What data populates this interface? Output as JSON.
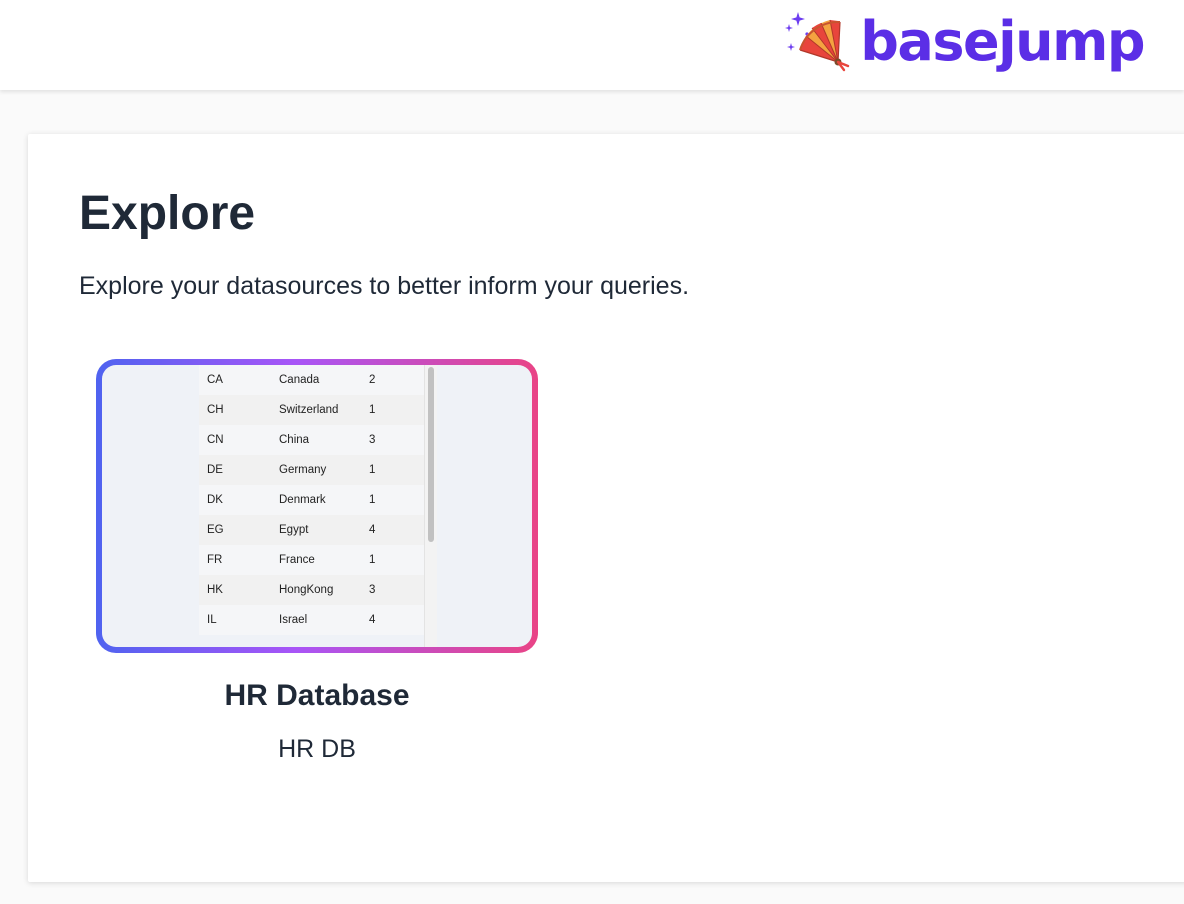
{
  "header": {
    "logo_text": "basejump",
    "logo_icon": "fan-sparkles-icon",
    "brand_color": "#5b2ee6"
  },
  "page": {
    "title": "Explore",
    "subtitle": "Explore your datasources to better inform your queries."
  },
  "datasources": [
    {
      "name": "HR Database",
      "description": "HR DB",
      "preview_rows": [
        [
          "CA",
          "Canada",
          "2"
        ],
        [
          "CH",
          "Switzerland",
          "1"
        ],
        [
          "CN",
          "China",
          "3"
        ],
        [
          "DE",
          "Germany",
          "1"
        ],
        [
          "DK",
          "Denmark",
          "1"
        ],
        [
          "EG",
          "Egypt",
          "4"
        ],
        [
          "FR",
          "France",
          "1"
        ],
        [
          "HK",
          "HongKong",
          "3"
        ],
        [
          "IL",
          "Israel",
          "4"
        ]
      ]
    }
  ],
  "colors": {
    "gradient_start": "#4f63f0",
    "gradient_mid": "#a855f7",
    "gradient_end": "#e94486"
  }
}
